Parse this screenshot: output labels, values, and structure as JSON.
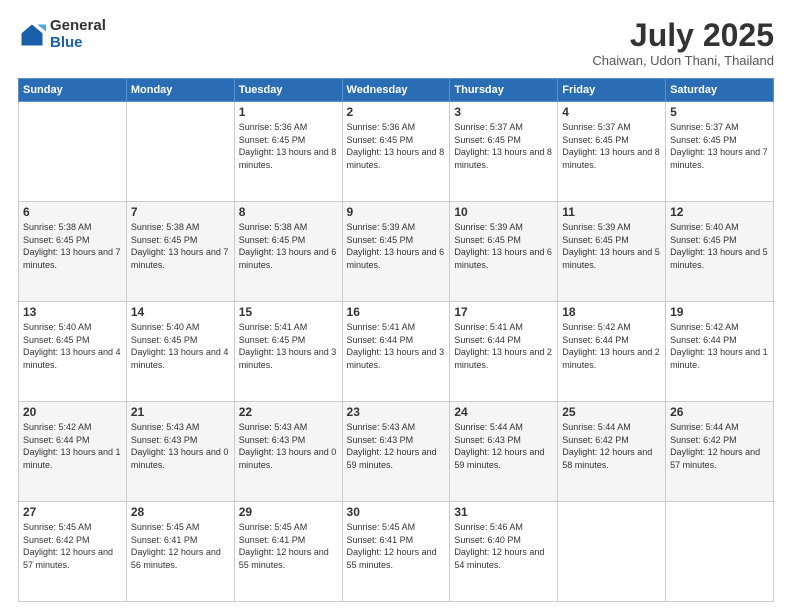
{
  "header": {
    "logo_general": "General",
    "logo_blue": "Blue",
    "title": "July 2025",
    "location": "Chaiwan, Udon Thani, Thailand"
  },
  "weekdays": [
    "Sunday",
    "Monday",
    "Tuesday",
    "Wednesday",
    "Thursday",
    "Friday",
    "Saturday"
  ],
  "weeks": [
    [
      {
        "day": "",
        "info": ""
      },
      {
        "day": "",
        "info": ""
      },
      {
        "day": "1",
        "info": "Sunrise: 5:36 AM\nSunset: 6:45 PM\nDaylight: 13 hours and 8 minutes."
      },
      {
        "day": "2",
        "info": "Sunrise: 5:36 AM\nSunset: 6:45 PM\nDaylight: 13 hours and 8 minutes."
      },
      {
        "day": "3",
        "info": "Sunrise: 5:37 AM\nSunset: 6:45 PM\nDaylight: 13 hours and 8 minutes."
      },
      {
        "day": "4",
        "info": "Sunrise: 5:37 AM\nSunset: 6:45 PM\nDaylight: 13 hours and 8 minutes."
      },
      {
        "day": "5",
        "info": "Sunrise: 5:37 AM\nSunset: 6:45 PM\nDaylight: 13 hours and 7 minutes."
      }
    ],
    [
      {
        "day": "6",
        "info": "Sunrise: 5:38 AM\nSunset: 6:45 PM\nDaylight: 13 hours and 7 minutes."
      },
      {
        "day": "7",
        "info": "Sunrise: 5:38 AM\nSunset: 6:45 PM\nDaylight: 13 hours and 7 minutes."
      },
      {
        "day": "8",
        "info": "Sunrise: 5:38 AM\nSunset: 6:45 PM\nDaylight: 13 hours and 6 minutes."
      },
      {
        "day": "9",
        "info": "Sunrise: 5:39 AM\nSunset: 6:45 PM\nDaylight: 13 hours and 6 minutes."
      },
      {
        "day": "10",
        "info": "Sunrise: 5:39 AM\nSunset: 6:45 PM\nDaylight: 13 hours and 6 minutes."
      },
      {
        "day": "11",
        "info": "Sunrise: 5:39 AM\nSunset: 6:45 PM\nDaylight: 13 hours and 5 minutes."
      },
      {
        "day": "12",
        "info": "Sunrise: 5:40 AM\nSunset: 6:45 PM\nDaylight: 13 hours and 5 minutes."
      }
    ],
    [
      {
        "day": "13",
        "info": "Sunrise: 5:40 AM\nSunset: 6:45 PM\nDaylight: 13 hours and 4 minutes."
      },
      {
        "day": "14",
        "info": "Sunrise: 5:40 AM\nSunset: 6:45 PM\nDaylight: 13 hours and 4 minutes."
      },
      {
        "day": "15",
        "info": "Sunrise: 5:41 AM\nSunset: 6:45 PM\nDaylight: 13 hours and 3 minutes."
      },
      {
        "day": "16",
        "info": "Sunrise: 5:41 AM\nSunset: 6:44 PM\nDaylight: 13 hours and 3 minutes."
      },
      {
        "day": "17",
        "info": "Sunrise: 5:41 AM\nSunset: 6:44 PM\nDaylight: 13 hours and 2 minutes."
      },
      {
        "day": "18",
        "info": "Sunrise: 5:42 AM\nSunset: 6:44 PM\nDaylight: 13 hours and 2 minutes."
      },
      {
        "day": "19",
        "info": "Sunrise: 5:42 AM\nSunset: 6:44 PM\nDaylight: 13 hours and 1 minute."
      }
    ],
    [
      {
        "day": "20",
        "info": "Sunrise: 5:42 AM\nSunset: 6:44 PM\nDaylight: 13 hours and 1 minute."
      },
      {
        "day": "21",
        "info": "Sunrise: 5:43 AM\nSunset: 6:43 PM\nDaylight: 13 hours and 0 minutes."
      },
      {
        "day": "22",
        "info": "Sunrise: 5:43 AM\nSunset: 6:43 PM\nDaylight: 13 hours and 0 minutes."
      },
      {
        "day": "23",
        "info": "Sunrise: 5:43 AM\nSunset: 6:43 PM\nDaylight: 12 hours and 59 minutes."
      },
      {
        "day": "24",
        "info": "Sunrise: 5:44 AM\nSunset: 6:43 PM\nDaylight: 12 hours and 59 minutes."
      },
      {
        "day": "25",
        "info": "Sunrise: 5:44 AM\nSunset: 6:42 PM\nDaylight: 12 hours and 58 minutes."
      },
      {
        "day": "26",
        "info": "Sunrise: 5:44 AM\nSunset: 6:42 PM\nDaylight: 12 hours and 57 minutes."
      }
    ],
    [
      {
        "day": "27",
        "info": "Sunrise: 5:45 AM\nSunset: 6:42 PM\nDaylight: 12 hours and 57 minutes."
      },
      {
        "day": "28",
        "info": "Sunrise: 5:45 AM\nSunset: 6:41 PM\nDaylight: 12 hours and 56 minutes."
      },
      {
        "day": "29",
        "info": "Sunrise: 5:45 AM\nSunset: 6:41 PM\nDaylight: 12 hours and 55 minutes."
      },
      {
        "day": "30",
        "info": "Sunrise: 5:45 AM\nSunset: 6:41 PM\nDaylight: 12 hours and 55 minutes."
      },
      {
        "day": "31",
        "info": "Sunrise: 5:46 AM\nSunset: 6:40 PM\nDaylight: 12 hours and 54 minutes."
      },
      {
        "day": "",
        "info": ""
      },
      {
        "day": "",
        "info": ""
      }
    ]
  ]
}
